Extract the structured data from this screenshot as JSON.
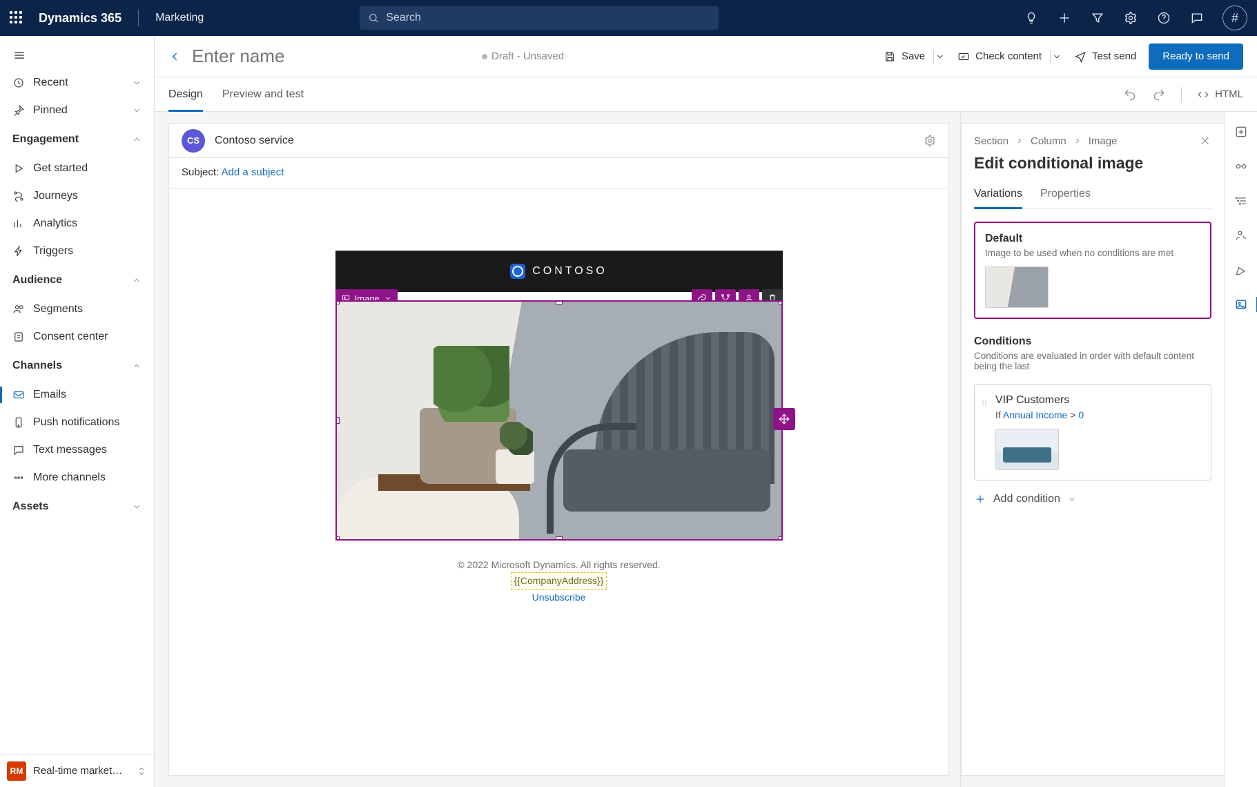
{
  "top": {
    "brand": "Dynamics 365",
    "module": "Marketing",
    "search_placeholder": "Search",
    "avatar_glyph": "#"
  },
  "nav": {
    "recent": "Recent",
    "pinned": "Pinned",
    "sections": {
      "engagement": "Engagement",
      "audience": "Audience",
      "channels": "Channels",
      "assets": "Assets"
    },
    "engagement_items": {
      "get_started": "Get started",
      "journeys": "Journeys",
      "analytics": "Analytics",
      "triggers": "Triggers"
    },
    "audience_items": {
      "segments": "Segments",
      "consent_center": "Consent center"
    },
    "channel_items": {
      "emails": "Emails",
      "push": "Push notifications",
      "text": "Text messages",
      "more": "More channels"
    },
    "switcher": {
      "badge": "RM",
      "label": "Real-time marketi…"
    }
  },
  "cmd": {
    "title_placeholder": "Enter name",
    "status": "Draft - Unsaved",
    "save": "Save",
    "check": "Check content",
    "test": "Test send",
    "ready": "Ready to send"
  },
  "tabs": {
    "design": "Design",
    "preview": "Preview and test",
    "html": "HTML"
  },
  "canvas": {
    "sender": "Contoso service",
    "sender_initials": "CS",
    "subject_label": "Subject: ",
    "subject_link": "Add a subject",
    "brand_text": "CONTOSO",
    "sel_label": "Image",
    "footer_copy": "© 2022 Microsoft Dynamics. All rights reserved.",
    "footer_addr": "{{CompanyAddress}}",
    "footer_unsub": "Unsubscribe"
  },
  "panel": {
    "bc_section": "Section",
    "bc_column": "Column",
    "bc_image": "Image",
    "title": "Edit conditional image",
    "tab_variations": "Variations",
    "tab_properties": "Properties",
    "default_title": "Default",
    "default_desc": "Image to be used when no conditions are met",
    "conditions_title": "Conditions",
    "conditions_desc": "Conditions are evaluated in order with default content being the last",
    "cond1_title": "VIP Customers",
    "cond1_if": "If ",
    "cond1_field": "Annual Income",
    "cond1_op": " > ",
    "cond1_val": "0",
    "add_condition": "Add condition"
  }
}
